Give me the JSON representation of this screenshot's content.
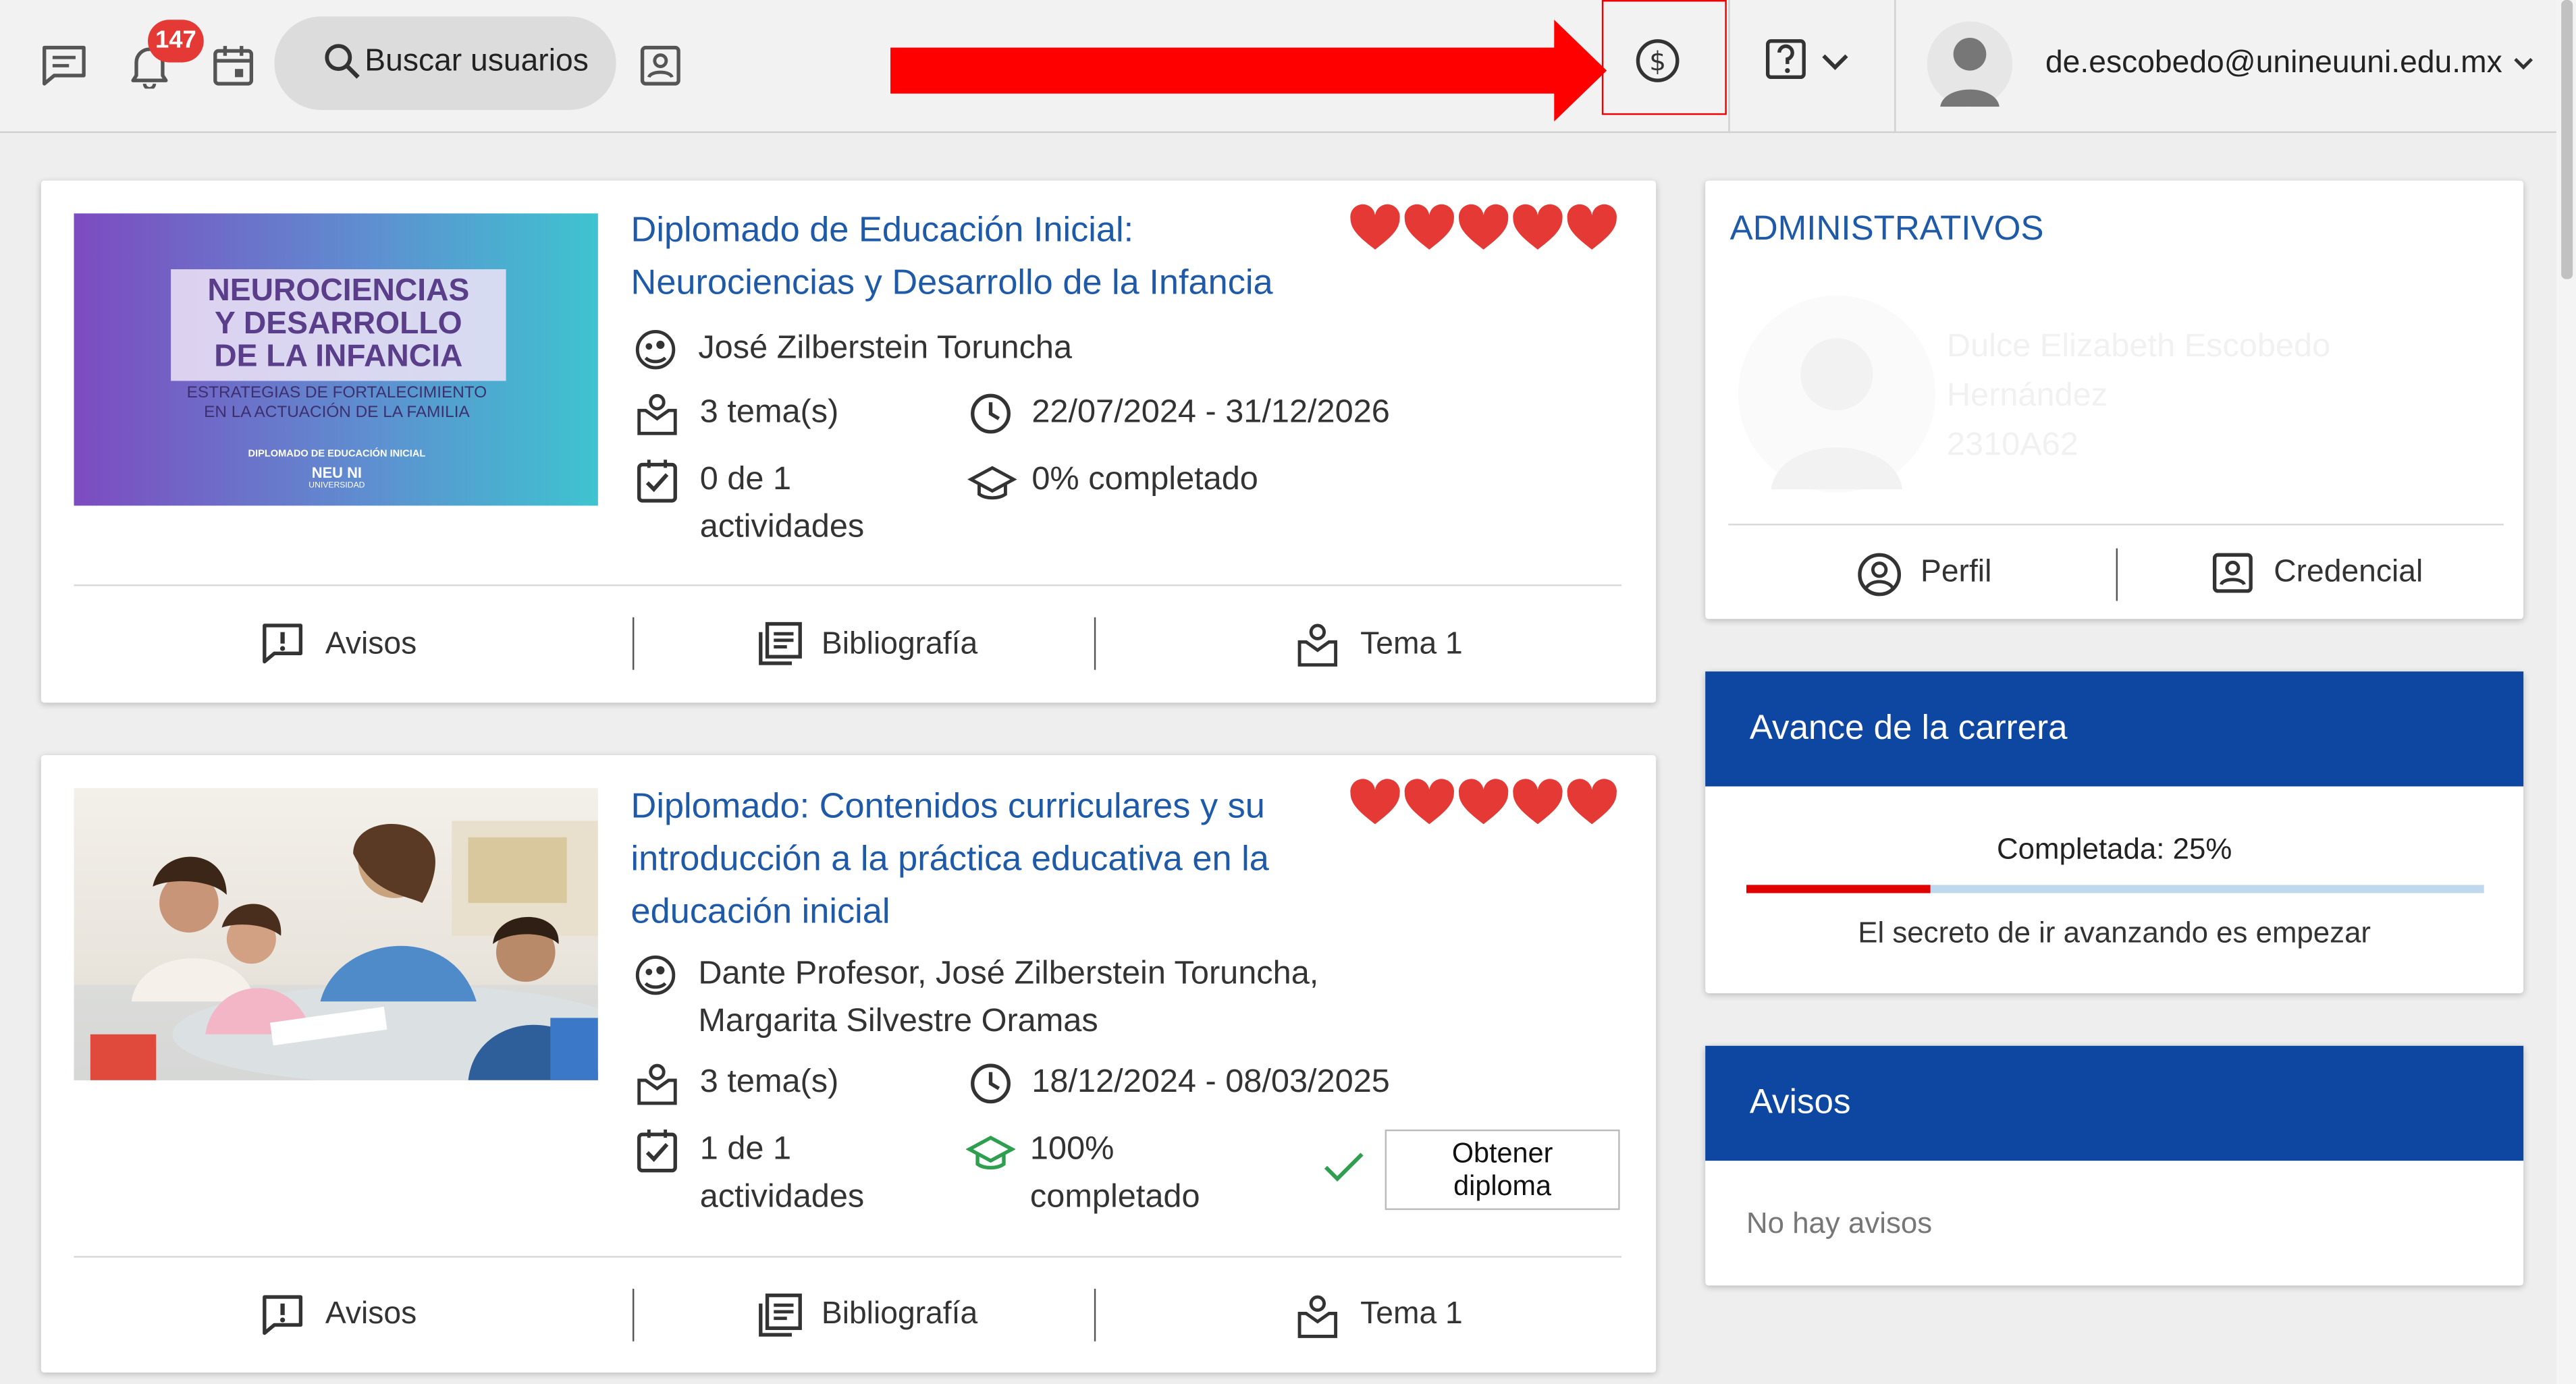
{
  "header": {
    "notification_count": "147",
    "search_label": "Buscar usuarios",
    "user_email": "de.escobedo@unineuuni.edu.mx"
  },
  "courses": [
    {
      "title_line1": "Diplomado de Educación Inicial:",
      "title_line2": "Neurociencias y Desarrollo de la Infancia",
      "title_line3": "",
      "image_text_1": "NEUROCIENCIAS",
      "image_text_2": "Y DESARROLLO",
      "image_text_3": "DE LA INFANCIA",
      "image_subtext_1": "ESTRATEGIAS DE FORTALECIMIENTO",
      "image_subtext_2": "EN LA ACTUACIÓN DE LA FAMILIA",
      "image_caption": "DIPLOMADO DE EDUCACIÓN INICIAL",
      "image_logo": "NEU NI",
      "image_logo_sub": "UNIVERSIDAD",
      "rating": 5,
      "teachers_line1": "José Zilberstein Toruncha",
      "teachers_line2": "",
      "topics": "3 tema(s)",
      "dates": "22/07/2024 - 31/12/2026",
      "activities_line1": "0 de 1",
      "activities_line2": "actividades",
      "progress_line1": "0% completado",
      "progress_line2": "",
      "footer": {
        "avisos": "Avisos",
        "bibliografia": "Bibliografía",
        "tema": "Tema 1"
      }
    },
    {
      "title_line1": "Diplomado: Contenidos curriculares y su",
      "title_line2": "introducción a la práctica educativa en la",
      "title_line3": "educación inicial",
      "rating": 5,
      "teachers_line1": "Dante Profesor, José Zilberstein Toruncha,",
      "teachers_line2": "Margarita Silvestre Oramas",
      "topics": "3 tema(s)",
      "dates": "18/12/2024 - 08/03/2025",
      "activities_line1": "1 de 1",
      "activities_line2": "actividades",
      "progress_line1": "100%",
      "progress_line2": "completado",
      "diploma_line1": "Obtener",
      "diploma_line2": "diploma",
      "footer": {
        "avisos": "Avisos",
        "bibliografia": "Bibliografía",
        "tema": "Tema 1"
      }
    }
  ],
  "administrativos": {
    "title": "ADMINISTRATIVOS",
    "name_line1": "Dulce Elizabeth Escobedo",
    "name_line2": "Hernández",
    "code": "2310A62",
    "perfil_label": "Perfil",
    "credencial_label": "Credencial"
  },
  "career_progress": {
    "title": "Avance de la carrera",
    "completed_label": "Completada: 25%",
    "percent": 25,
    "motto": "El secreto de ir avanzando es empezar"
  },
  "notices_panel": {
    "title": "Avisos",
    "empty_text": "No hay avisos"
  },
  "colors": {
    "accent_blue": "#1e5aa8",
    "header_blue": "#0d47a1",
    "heart_red": "#e53935",
    "annotation_red": "#ff0000",
    "progress_red": "#e00000",
    "check_green": "#2e9e4f"
  }
}
